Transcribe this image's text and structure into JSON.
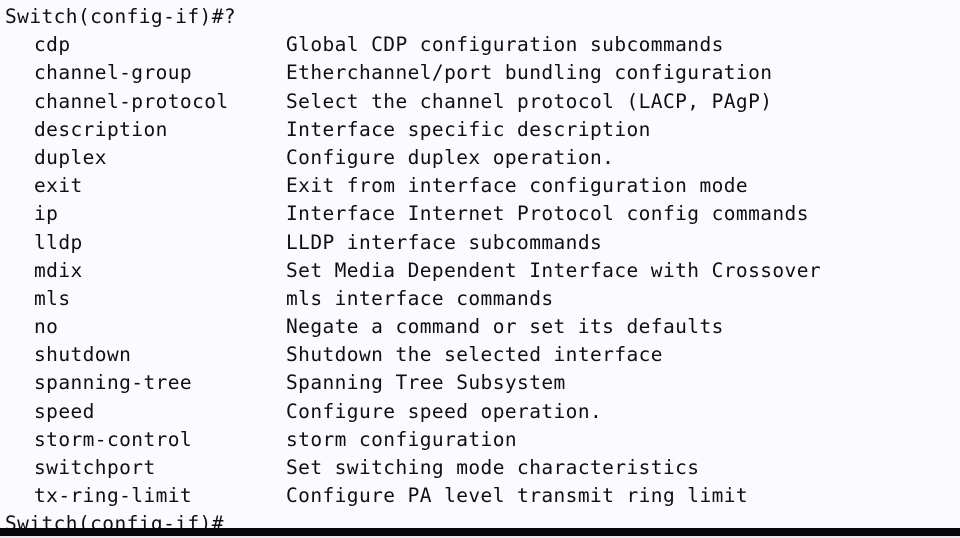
{
  "terminal": {
    "device_hostname": "Switch",
    "mode": "config-if",
    "prompt_text": "Switch(config-if)#",
    "prompt_symbol": "#",
    "help_query": "?",
    "header_line": "Switch(config-if)#?",
    "footer_line": "Switch(config-if)#",
    "background_color": "#fbfafc",
    "text_color": "#100e12",
    "bottom_bar_color": "#07060a",
    "commands": [
      {
        "name": "cdp",
        "description": "Global CDP configuration subcommands"
      },
      {
        "name": "channel-group",
        "description": "Etherchannel/port bundling configuration"
      },
      {
        "name": "channel-protocol",
        "description": "Select the channel protocol (LACP, PAgP)"
      },
      {
        "name": "description",
        "description": "Interface specific description"
      },
      {
        "name": "duplex",
        "description": "Configure duplex operation."
      },
      {
        "name": "exit",
        "description": "Exit from interface configuration mode"
      },
      {
        "name": "ip",
        "description": "Interface Internet Protocol config commands"
      },
      {
        "name": "lldp",
        "description": "LLDP interface subcommands"
      },
      {
        "name": "mdix",
        "description": "Set Media Dependent Interface with Crossover"
      },
      {
        "name": "mls",
        "description": "mls interface commands"
      },
      {
        "name": "no",
        "description": "Negate a command or set its defaults"
      },
      {
        "name": "shutdown",
        "description": "Shutdown the selected interface"
      },
      {
        "name": "spanning-tree",
        "description": "Spanning Tree Subsystem"
      },
      {
        "name": "speed",
        "description": "Configure speed operation."
      },
      {
        "name": "storm-control",
        "description": "storm configuration"
      },
      {
        "name": "switchport",
        "description": "Set switching mode characteristics"
      },
      {
        "name": "tx-ring-limit",
        "description": "Configure PA level transmit ring limit"
      }
    ]
  }
}
